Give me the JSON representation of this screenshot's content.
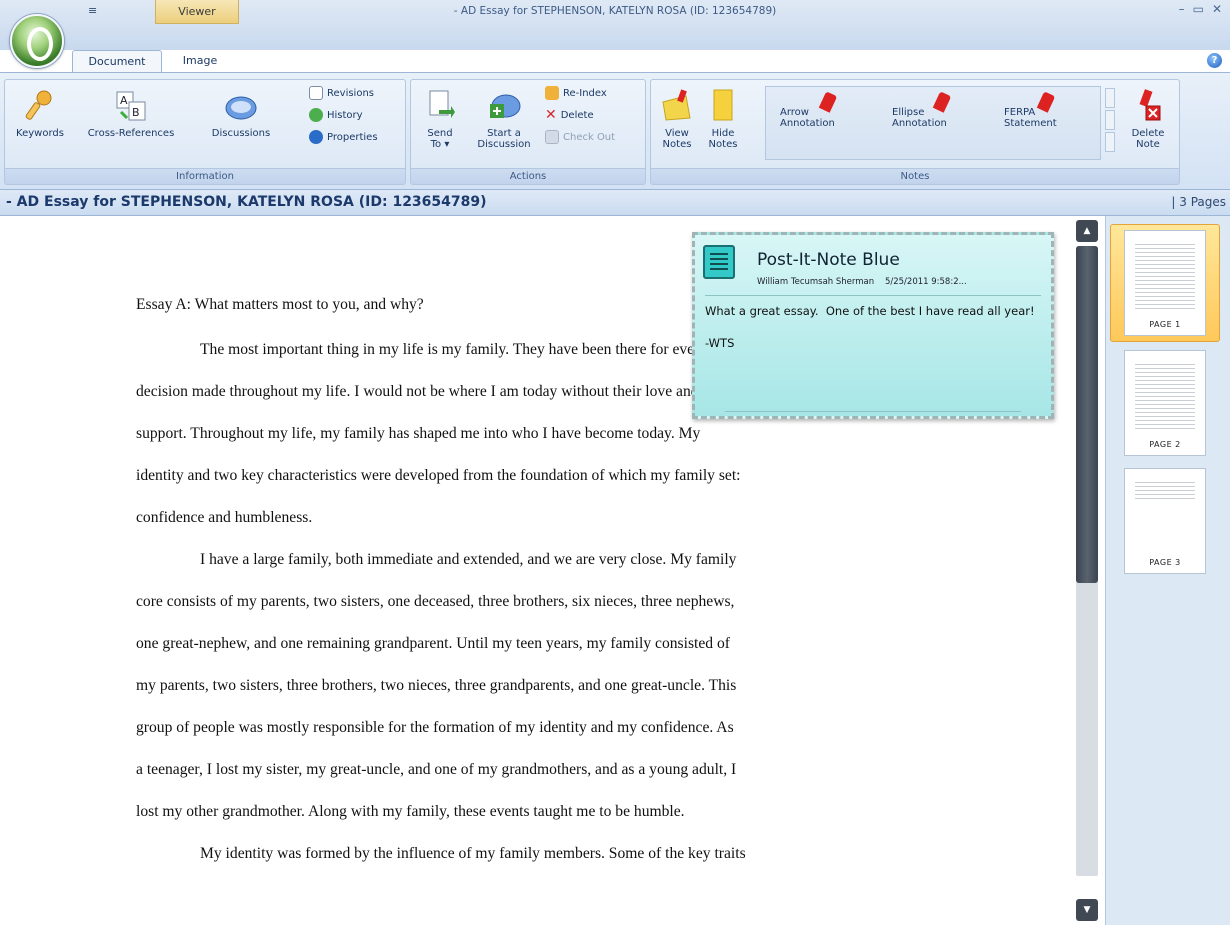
{
  "window": {
    "title": "- AD Essay for STEPHENSON, KATELYN ROSA (ID: 123654789)",
    "qat_glyph": "≡",
    "contextual_tab": "Viewer",
    "controls": {
      "minimize": "–",
      "maximize": "▭",
      "close": "✕"
    }
  },
  "ribbon": {
    "tabs": [
      {
        "label": "Document",
        "active": true
      },
      {
        "label": "Image",
        "active": false
      }
    ],
    "help_glyph": "?",
    "groups": {
      "information": {
        "label": "Information",
        "keywords": "Keywords",
        "cross_references": "Cross-References",
        "discussions": "Discussions",
        "revisions": "Revisions",
        "history": "History",
        "properties": "Properties"
      },
      "actions": {
        "label": "Actions",
        "send_to_line1": "Send",
        "send_to_line2": "To ▾",
        "start_line1": "Start a",
        "start_line2": "Discussion",
        "reindex": "Re-Index",
        "delete": "Delete",
        "check_out": "Check Out"
      },
      "notes": {
        "label": "Notes",
        "view_line1": "View",
        "view_line2": "Notes",
        "hide_line1": "Hide",
        "hide_line2": "Notes",
        "gallery": [
          {
            "line1": "Arrow",
            "line2": "Annotation"
          },
          {
            "line1": "Ellipse",
            "line2": "Annotation"
          },
          {
            "line1": "FERPA",
            "line2": "Statement"
          }
        ],
        "delete_line1": "Delete",
        "delete_line2": "Note"
      }
    }
  },
  "document": {
    "title": "- AD Essay for STEPHENSON, KATELYN ROSA (ID: 123654789)",
    "page_count": "| 3 Pages",
    "lines": [
      {
        "text": "Essay A: What matters most to you, and why?",
        "indent": false
      },
      {
        "text": "The most important thing in my life is my family. They have been there for every",
        "indent": true
      },
      {
        "text": "decision made throughout my life. I would not be where I am today without their love and",
        "indent": false
      },
      {
        "text": "support. Throughout my life, my family has shaped me into who I have become today. My",
        "indent": false
      },
      {
        "text": "identity and two key characteristics were developed from the foundation of which my family set:",
        "indent": false
      },
      {
        "text": "confidence and humbleness.",
        "indent": false
      },
      {
        "text": "I have a large family, both immediate and extended, and we are very close. My family",
        "indent": true
      },
      {
        "text": "core consists of my parents, two sisters, one deceased, three brothers, six nieces, three nephews,",
        "indent": false
      },
      {
        "text": "one great-nephew, and one remaining grandparent. Until my teen years, my family consisted of",
        "indent": false
      },
      {
        "text": "my parents, two sisters, three brothers, two nieces, three grandparents, and one great-uncle. This",
        "indent": false
      },
      {
        "text": "group of people was mostly responsible for the formation of my identity and my confidence. As",
        "indent": false
      },
      {
        "text": "a teenager, I lost my sister, my great-uncle, and one of my grandmothers, and as a young adult, I",
        "indent": false
      },
      {
        "text": "lost my other grandmother. Along with my family, these events taught me to be humble.",
        "indent": false
      },
      {
        "text": "My identity was formed by the influence of my family members. Some of the key traits",
        "indent": true
      }
    ]
  },
  "note": {
    "title": "Post-It-Note Blue",
    "author": "William Tecumsah Sherman",
    "timestamp": "5/25/2011 9:58:2...",
    "body": "What a great essay.  One of the best I have read all year!\n\n-WTS",
    "color": "#a7e6e6"
  },
  "scrollbar": {
    "up_glyph": "▲",
    "down_glyph": "▼"
  },
  "thumbnails": [
    {
      "label": "PAGE 1",
      "selected": true
    },
    {
      "label": "PAGE 2",
      "selected": false
    },
    {
      "label": "PAGE 3",
      "selected": false
    }
  ],
  "colors": {
    "accent": "#1b3a6b",
    "selection": "#ffc85a"
  }
}
